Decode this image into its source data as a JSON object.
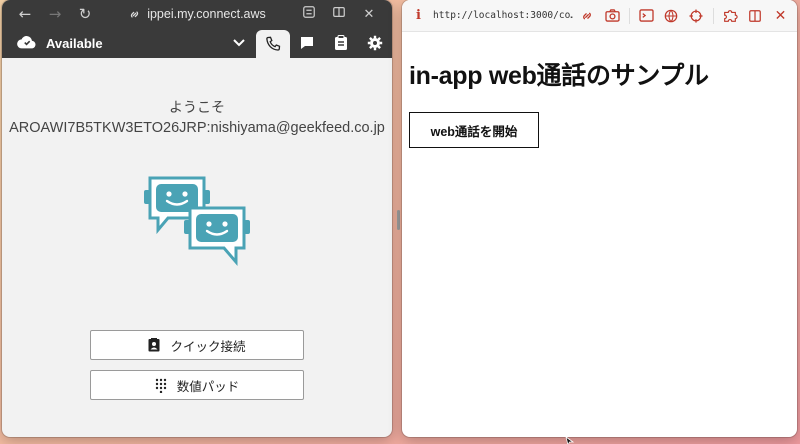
{
  "left_window": {
    "url": "ippei.my.connect.aws",
    "ccp": {
      "status": "Available",
      "welcome": "ようこそ",
      "username": "AROAWI7B5TKW3ETO26JRP:nishiyama@geekfeed.co.jp",
      "buttons": {
        "quick_connect": "クイック接続",
        "dialpad": "数値パッド"
      }
    }
  },
  "right_window": {
    "url": "http://localhost:3000/co…",
    "heading": "in-app web通話のサンプル",
    "start_button": "web通話を開始"
  },
  "colors": {
    "dark_bar": "#3a3a3a",
    "robot_teal": "#4aa3b5",
    "firefox_icon_red": "#c0392b"
  }
}
